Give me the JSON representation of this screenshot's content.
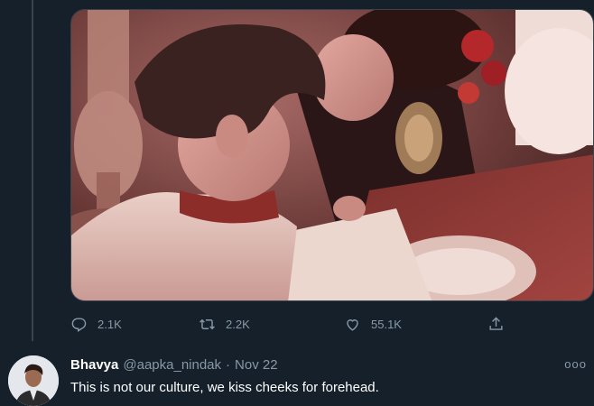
{
  "tweet": {
    "stats": {
      "replies": "2.1K",
      "retweets": "2.2K",
      "likes": "55.1K"
    },
    "icons": {
      "reply": "reply-icon",
      "retweet": "retweet-icon",
      "like": "heart-icon",
      "share": "share-icon"
    }
  },
  "reply": {
    "name": "Bhavya",
    "handle": "@aapka_nindak",
    "separator": "·",
    "date": "Nov 22",
    "text": "This is not our culture, we kiss cheeks for forehead.",
    "more": "ooo"
  },
  "colors": {
    "background": "#15202b",
    "secondary_text": "#8899a6",
    "border": "#38444d"
  }
}
